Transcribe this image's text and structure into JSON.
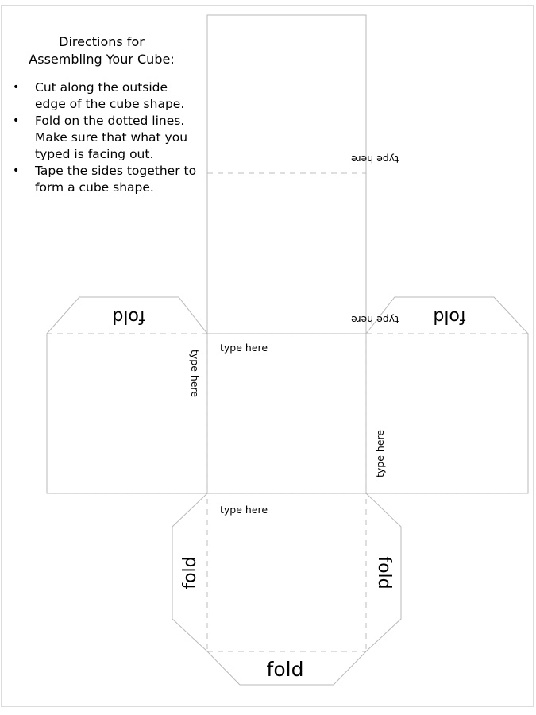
{
  "document": {
    "kind": "printable-cube-net-template",
    "background_color": "#ffffff",
    "cut_line_color": "#b9b9b9",
    "fold_line_color": "#bdbdbd",
    "text_color": "#000000"
  },
  "directions": {
    "title_line_1": "Directions for",
    "title_line_2": "Assembling Your Cube:",
    "bullet_glyph": "•",
    "items": [
      "Cut along the outside edge of the cube shape.",
      "Fold on the dotted lines. Make sure that what you typed is facing out.",
      "Tape the sides together to form a cube shape."
    ]
  },
  "net": {
    "type_here_label": "type here",
    "fold_label": "fold",
    "faces": [
      {
        "name": "top-face",
        "label": "type here",
        "label_rotation_deg": 180,
        "label_position": "bottom-right"
      },
      {
        "name": "upper-middle-face",
        "label": "type here",
        "label_rotation_deg": 180,
        "label_position": "bottom-right"
      },
      {
        "name": "center-face",
        "label": "type here",
        "label_rotation_deg": 0,
        "label_position": "top-left"
      },
      {
        "name": "left-face",
        "label": "type here",
        "label_rotation_deg": 90,
        "label_position": "right-edge"
      },
      {
        "name": "right-face",
        "label": "type here",
        "label_rotation_deg": 270,
        "label_position": "left-edge"
      },
      {
        "name": "bottom-face",
        "label": "type here",
        "label_rotation_deg": 0,
        "label_position": "top-left"
      }
    ],
    "tabs": [
      {
        "name": "left-wing-top-tab",
        "label": "fold",
        "rotation_deg": 180
      },
      {
        "name": "right-wing-top-tab",
        "label": "fold",
        "rotation_deg": 180
      },
      {
        "name": "bottom-left-tab",
        "label": "fold",
        "rotation_deg": 270
      },
      {
        "name": "bottom-right-tab",
        "label": "fold",
        "rotation_deg": 90
      },
      {
        "name": "bottom-bottom-tab",
        "label": "fold",
        "rotation_deg": 0
      }
    ]
  }
}
